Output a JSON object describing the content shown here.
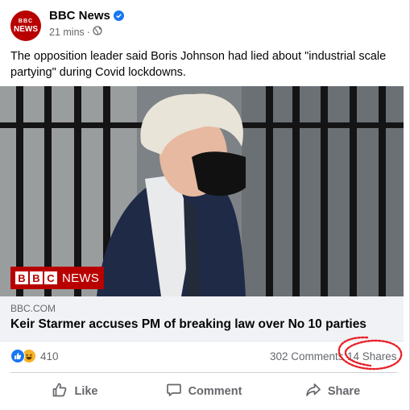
{
  "post": {
    "page_name": "BBC News",
    "avatar_top": "BBC",
    "avatar_bottom": "NEWS",
    "time": "21 mins",
    "separator": "·",
    "audience_icon": "globe-icon",
    "caption": "The opposition leader said Boris Johnson had lied about \"industrial scale partying\" during Covid lockdowns."
  },
  "image": {
    "logo_letters": [
      "B",
      "B",
      "C"
    ],
    "logo_word": "NEWS"
  },
  "link_preview": {
    "domain": "BBC.COM",
    "headline": "Keir Starmer accuses PM of breaking law over No 10 parties"
  },
  "stats": {
    "reaction_count": "410",
    "comments": "302 Comments",
    "shares": "14 Shares"
  },
  "actions": {
    "like": "Like",
    "comment": "Comment",
    "share": "Share"
  },
  "colors": {
    "brand_red": "#b80000",
    "fb_blue": "#1877f2",
    "annotation_red": "#e8222a"
  }
}
